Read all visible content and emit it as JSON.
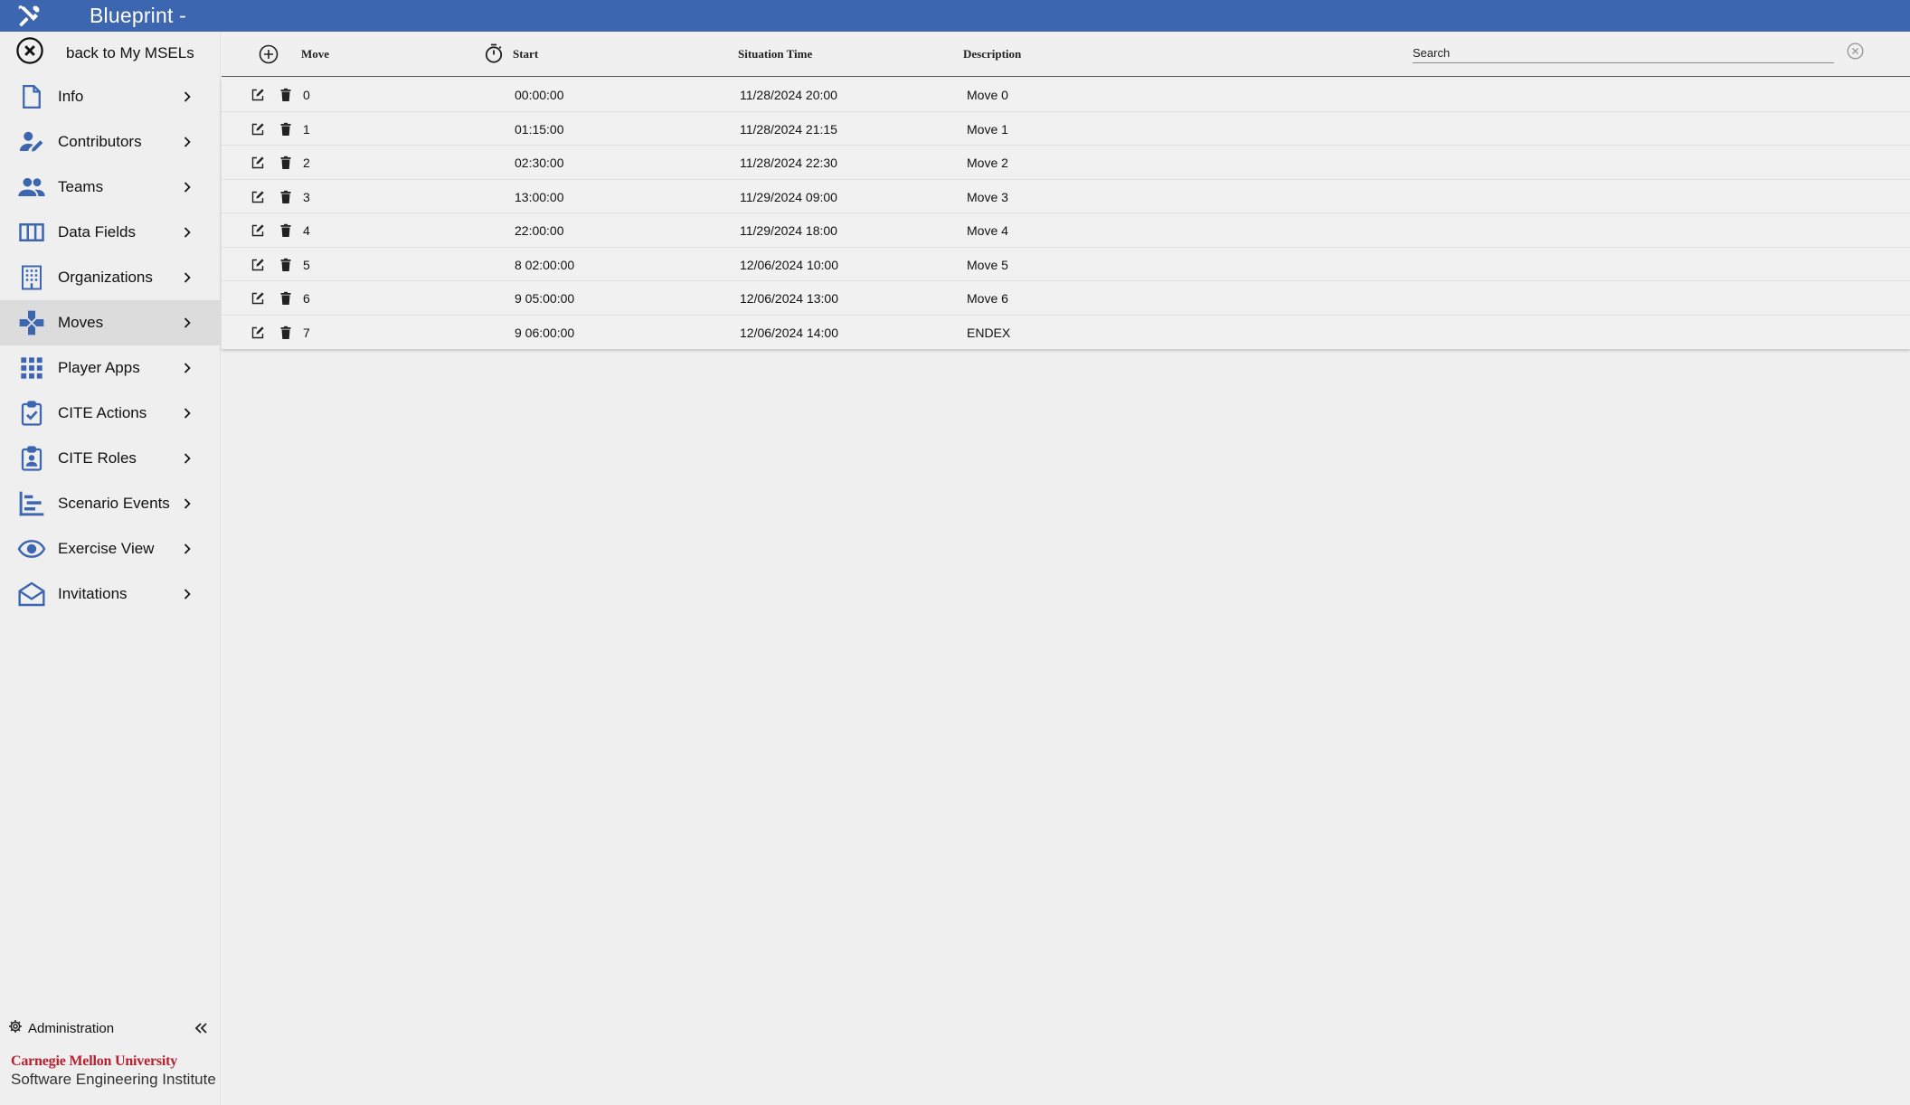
{
  "app": {
    "title": "Blueprint -"
  },
  "sidebar": {
    "back_label": "back to My MSELs",
    "items": [
      {
        "label": "Info",
        "icon": "document-icon"
      },
      {
        "label": "Contributors",
        "icon": "user-edit-icon"
      },
      {
        "label": "Teams",
        "icon": "people-icon"
      },
      {
        "label": "Data Fields",
        "icon": "columns-icon"
      },
      {
        "label": "Organizations",
        "icon": "building-icon"
      },
      {
        "label": "Moves",
        "icon": "gamepad-icon",
        "active": true
      },
      {
        "label": "Player Apps",
        "icon": "apps-grid-icon"
      },
      {
        "label": "CITE Actions",
        "icon": "clipboard-check-icon"
      },
      {
        "label": "CITE Roles",
        "icon": "badge-icon"
      },
      {
        "label": "Scenario Events",
        "icon": "timeline-icon"
      },
      {
        "label": "Exercise View",
        "icon": "eye-icon"
      },
      {
        "label": "Invitations",
        "icon": "envelope-icon"
      }
    ],
    "admin_label": "Administration",
    "footer": {
      "line1": "Carnegie Mellon University",
      "line2": "Software Engineering Institute"
    }
  },
  "table": {
    "headers": {
      "move": "Move",
      "start": "Start",
      "situation": "Situation Time",
      "description": "Description"
    },
    "search_placeholder": "Search",
    "rows": [
      {
        "move": "0",
        "start": "00:00:00",
        "situation": "11/28/2024 20:00",
        "description": "Move 0"
      },
      {
        "move": "1",
        "start": "01:15:00",
        "situation": "11/28/2024 21:15",
        "description": "Move 1"
      },
      {
        "move": "2",
        "start": "02:30:00",
        "situation": "11/28/2024 22:30",
        "description": "Move 2"
      },
      {
        "move": "3",
        "start": "13:00:00",
        "situation": "11/29/2024 09:00",
        "description": "Move 3"
      },
      {
        "move": "4",
        "start": "22:00:00",
        "situation": "11/29/2024 18:00",
        "description": "Move 4"
      },
      {
        "move": "5",
        "start": "8 02:00:00",
        "situation": "12/06/2024 10:00",
        "description": "Move 5"
      },
      {
        "move": "6",
        "start": "9 05:00:00",
        "situation": "12/06/2024 13:00",
        "description": "Move 6"
      },
      {
        "move": "7",
        "start": "9 06:00:00",
        "situation": "12/06/2024 14:00",
        "description": "ENDEX"
      }
    ]
  },
  "colors": {
    "topbar": "#3c66b0",
    "icon_blue": "#3c66b0",
    "active_bg": "#dcdcdc",
    "cmu_red": "#b51f2e"
  }
}
